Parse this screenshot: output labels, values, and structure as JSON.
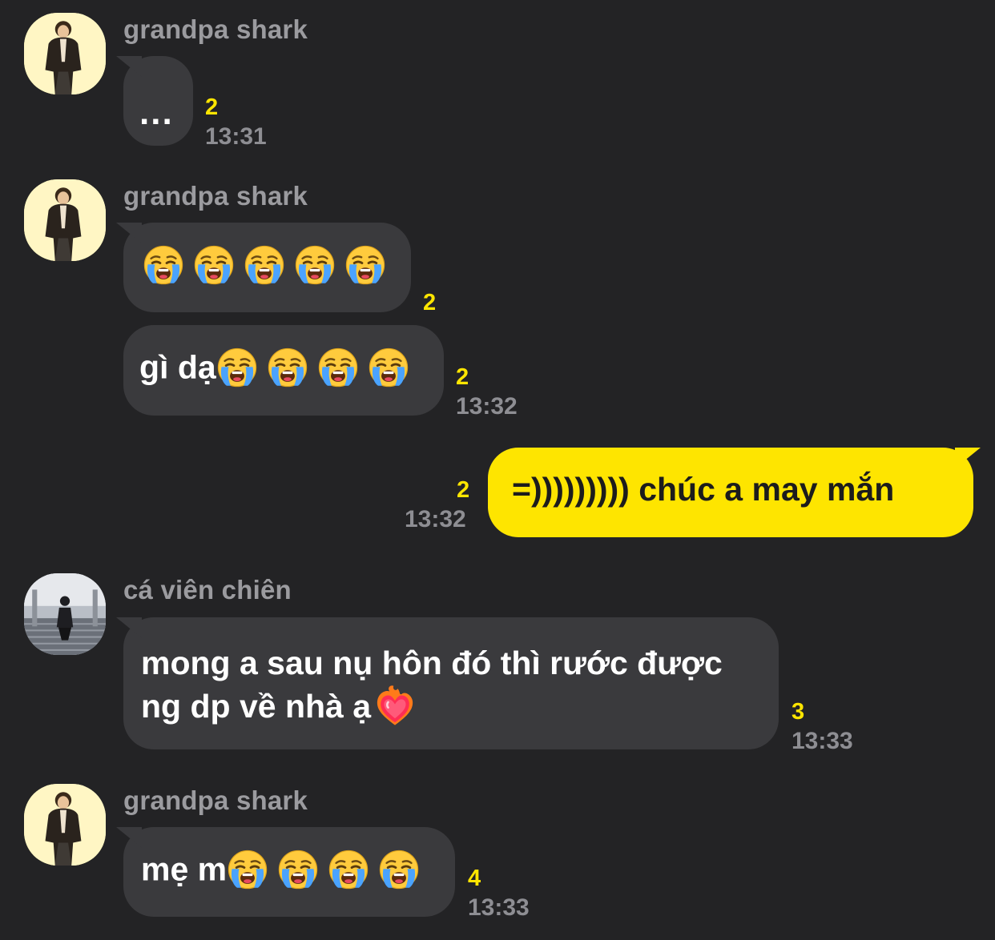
{
  "messages": [
    {
      "sender": "grandpa shark",
      "avatar": "avatar-photo",
      "text": "...",
      "unread": "2",
      "time": "13:31"
    },
    {
      "sender": "grandpa shark",
      "avatar": "avatar-photo",
      "emojis": [
        "loudly-crying-face-icon",
        "loudly-crying-face-icon",
        "loudly-crying-face-icon",
        "loudly-crying-face-icon",
        "loudly-crying-face-icon"
      ],
      "unread": "2"
    },
    {
      "text": "gì dạ",
      "emojis": [
        "loudly-crying-face-icon",
        "loudly-crying-face-icon",
        "loudly-crying-face-icon",
        "loudly-crying-face-icon"
      ],
      "unread": "2",
      "time": "13:32"
    },
    {
      "own": true,
      "text": "=))))))))) chúc a may mắn",
      "unread": "2",
      "time": "13:32"
    },
    {
      "sender": "cá viên chiên",
      "avatar": "avatar-photo",
      "text_line1": "mong a sau nụ hôn đó thì rước được",
      "text_line2": "ng dp về nhà ạ",
      "emojis": [
        "heart-on-fire-icon"
      ],
      "unread": "3",
      "time": "13:33"
    },
    {
      "sender": "grandpa shark",
      "avatar": "avatar-photo",
      "text": "mẹ m",
      "emojis": [
        "loudly-crying-face-icon",
        "loudly-crying-face-icon",
        "loudly-crying-face-icon",
        "loudly-crying-face-icon"
      ],
      "unread": "4",
      "time": "13:33"
    }
  ],
  "colors": {
    "background": "#232325",
    "incoming_bubble": "#3a3a3d",
    "outgoing_bubble": "#fee500",
    "unread_count": "#fee500",
    "timestamp": "#8e8e93",
    "sender_name": "#9b9b9f"
  }
}
